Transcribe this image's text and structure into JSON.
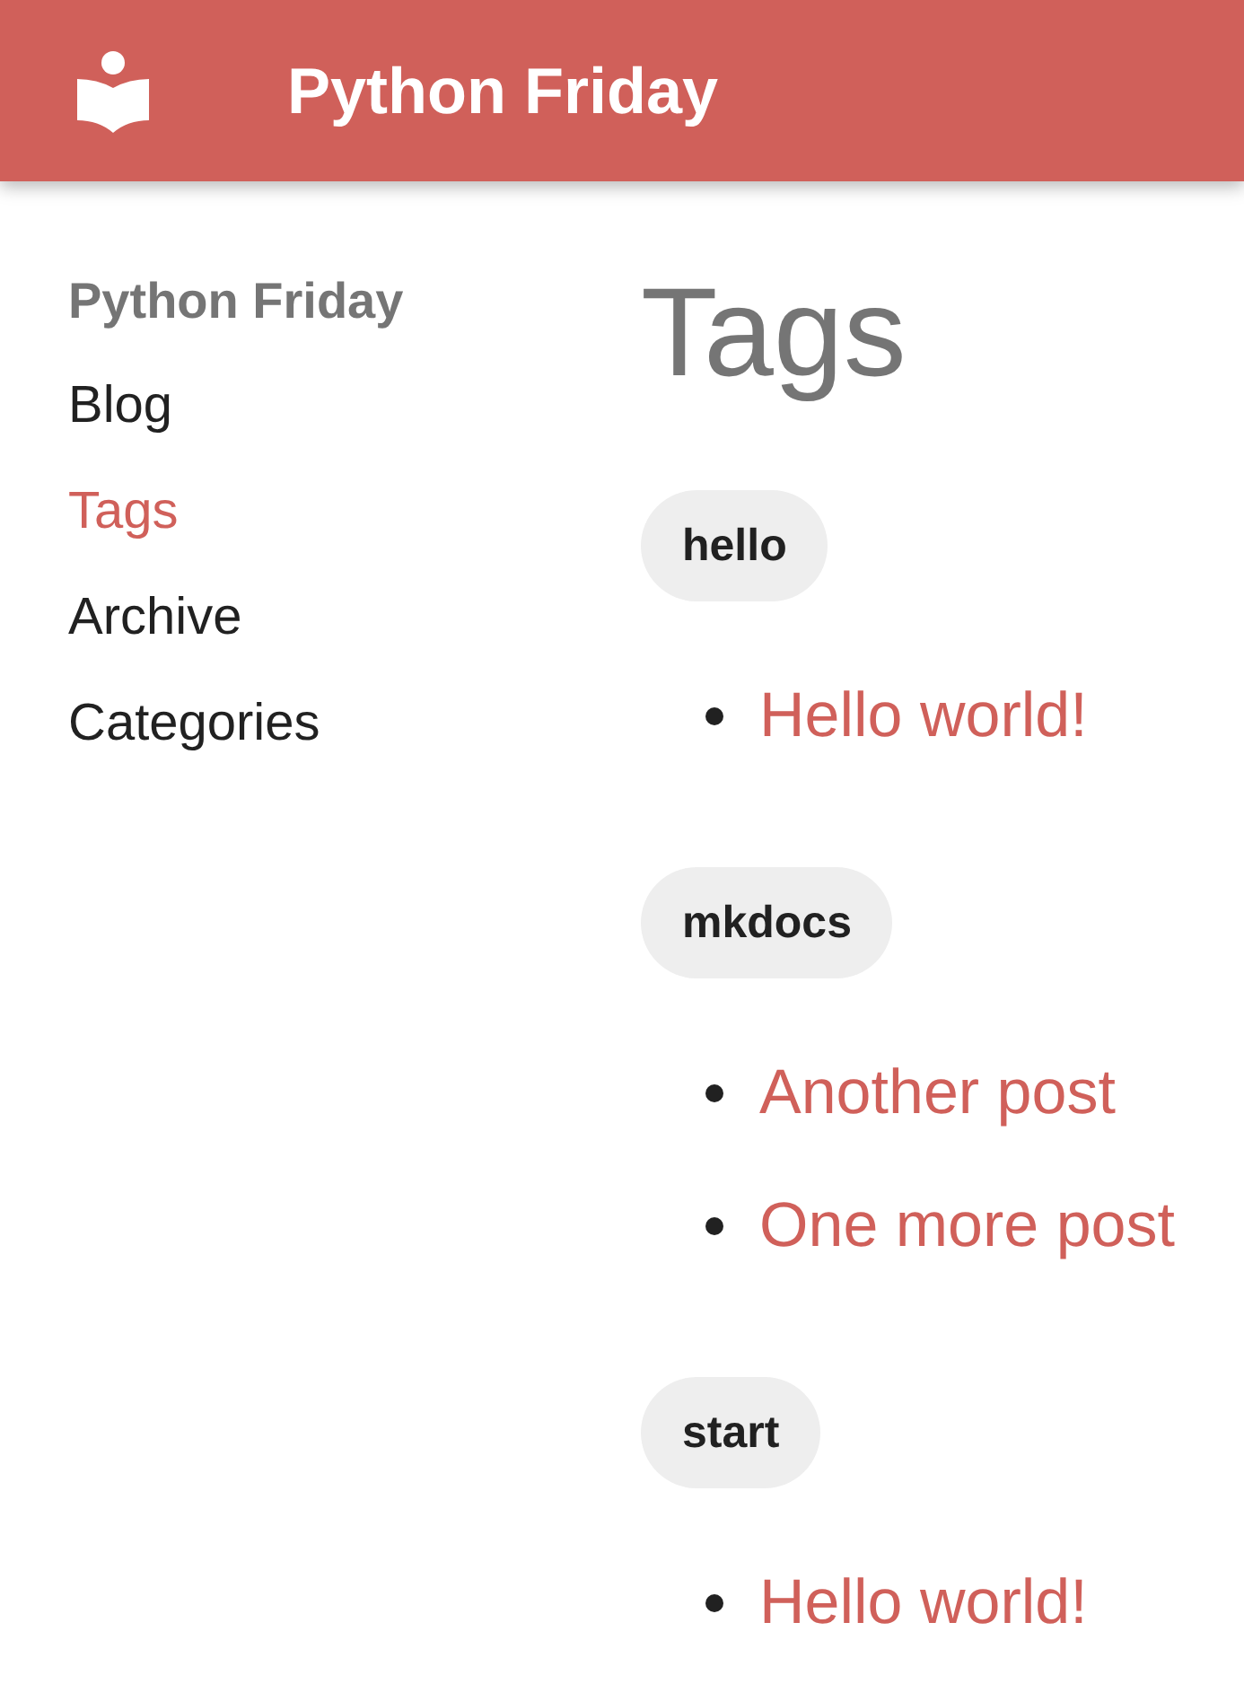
{
  "header": {
    "title": "Python Friday"
  },
  "sidebar": {
    "title": "Python Friday",
    "items": [
      {
        "label": "Blog",
        "selected": false
      },
      {
        "label": "Tags",
        "selected": true
      },
      {
        "label": "Archive",
        "selected": false
      },
      {
        "label": "Categories",
        "selected": false
      }
    ]
  },
  "content": {
    "heading": "Tags",
    "groups": [
      {
        "tag": "hello",
        "posts": [
          "Hello world!"
        ]
      },
      {
        "tag": "mkdocs",
        "posts": [
          "Another post",
          "One more post"
        ]
      },
      {
        "tag": "start",
        "posts": [
          "Hello world!"
        ]
      }
    ]
  }
}
